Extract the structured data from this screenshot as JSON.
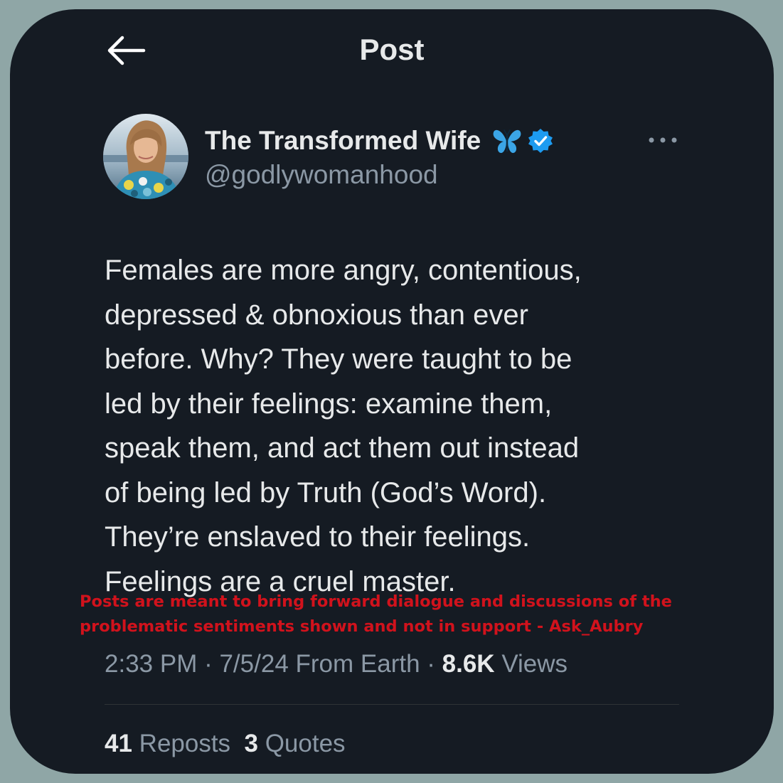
{
  "header": {
    "title": "Post",
    "back_icon": "arrow-left-icon"
  },
  "author": {
    "display_name": "The Transformed Wife",
    "emoji": "butterfly-emoji",
    "verified_icon": "verified-badge-icon",
    "handle": "@godlywomanhood",
    "more_icon": "more-horizontal-icon"
  },
  "post": {
    "text": "Females are more angry, contentious,\ndepressed & obnoxious than ever\nbefore. Why? They were taught to be\nled by their feelings: examine them,\nspeak them, and act them out instead\nof being led by Truth (God’s Word).\nThey’re enslaved to their feelings.\nFeelings are a cruel master."
  },
  "overlay": {
    "disclaimer": "Posts are meant to bring forward dialogue and discussions of the\nproblematic sentiments shown and not in support - Ask_Aubry"
  },
  "meta": {
    "time": "2:33 PM",
    "separator": " · ",
    "date": "7/5/24",
    "location": " From Earth",
    "views_count": "8.6K",
    "views_label": " Views"
  },
  "stats": {
    "reposts_count": "41",
    "reposts_label": " Reposts",
    "quotes_count": "3",
    "quotes_label": " Quotes"
  },
  "colors": {
    "background": "#151b23",
    "outer_background": "#8fa6a6",
    "primary_text": "#e7e9ea",
    "secondary_text": "#8b98a5",
    "verified_blue": "#1d9bf0",
    "disclaimer_red": "#d1121c"
  }
}
